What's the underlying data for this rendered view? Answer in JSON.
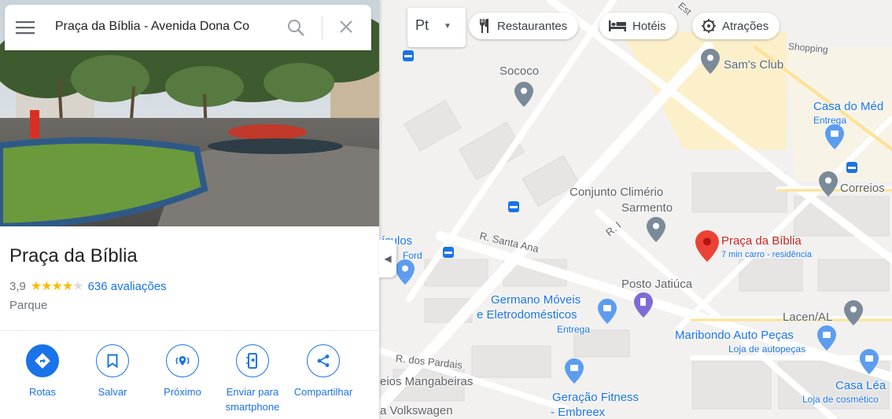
{
  "search": {
    "query": "Praça da Bíblia - Avenida Dona Co"
  },
  "place": {
    "name": "Praça da Bíblia",
    "rating": "3,9",
    "stars": 4,
    "reviews": "636 avaliações",
    "category": "Parque"
  },
  "actions": [
    {
      "label": "Rotas",
      "icon": "directions-icon"
    },
    {
      "label": "Salvar",
      "icon": "bookmark-icon"
    },
    {
      "label": "Próximo",
      "icon": "nearby-icon"
    },
    {
      "label": "Enviar para smartphone",
      "icon": "send-to-phone-icon"
    },
    {
      "label": "Compartilhar",
      "icon": "share-icon"
    }
  ],
  "layer": {
    "label": "Pt"
  },
  "chips": [
    {
      "label": "Restaurantes",
      "icon": "restaurant-icon"
    },
    {
      "label": "Hotéis",
      "icon": "hotel-icon"
    },
    {
      "label": "Atrações",
      "icon": "attractions-icon"
    }
  ],
  "map_labels": {
    "sococo": "Sococo",
    "sams_club": "Sam's Club",
    "shopping": "Shopping",
    "casa_do_med": "Casa do Méd",
    "entrega_1": "Entrega",
    "correios": "Correios",
    "conjunto_1": "Conjunto Climério",
    "conjunto_2": "Sarmento",
    "r_santa_ana": "R. Santa Ana",
    "r_i": "R. I",
    "veiculos": "ículos",
    "ford": "Ford",
    "praca_biblia": "Praça da Bíblia",
    "praca_sub": "7 min carro - residência",
    "posto": "Posto Jatiúca",
    "germano_1": "Germano Móveis",
    "germano_2": "e Eletrodomésticos",
    "entrega_2": "Entrega",
    "lacen": "Lacen/AL",
    "maribondo": "Maribondo Auto Peças",
    "maribondo_sub": "Loja de autopeças",
    "r_pardais": "R. dos Pardais",
    "mangabeiras": "eios Mangabeiras",
    "geracao_1": "Geração Fitness",
    "geracao_2": "- Embreex",
    "casa_lea": "Casa Léa",
    "casa_lea_sub": "Loja de cosmético",
    "volkswagen": "a Volkswagen",
    "est": "Est"
  },
  "colors": {
    "accent": "#1a73e8",
    "star": "#fbbc04",
    "pin_red": "#ea4335",
    "map_bg": "#f2f1ef",
    "road_yellow": "#fde293"
  }
}
